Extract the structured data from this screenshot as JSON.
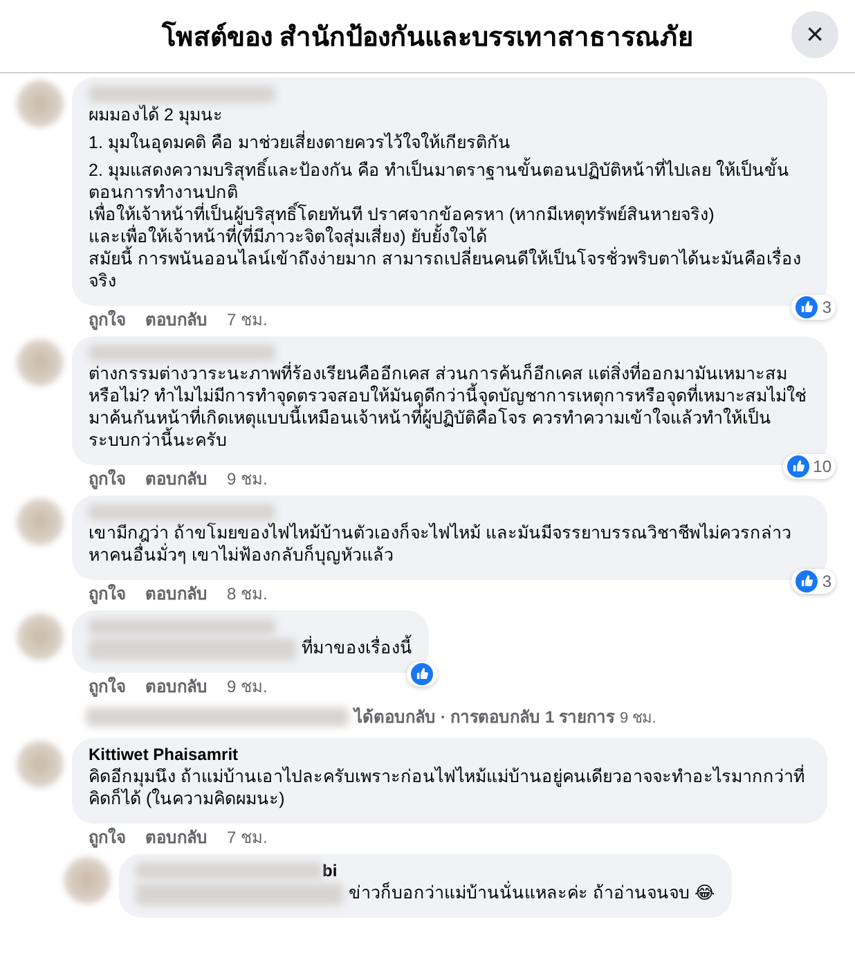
{
  "header": {
    "title": "โพสต์ของ สำนักป้องกันและบรรเทาสาธารณภัย",
    "close": "×"
  },
  "items": [
    {
      "kind": "comment",
      "name_blurred": true,
      "paragraphs": [
        "ผมมองได้ 2 มุมนะ",
        "1. มุมในอุดมคติ คือ มาช่วยเสี่ยงตายควรไว้ใจให้เกียรติกัน",
        "2. มุมแสดงความบริสุทธิ์และป้องกัน คือ ทำเป็นมาตราฐานขั้นตอนปฏิบัติหน้าที่ไปเลย ให้เป็นขั้นตอนการทำงานปกติ\nเพื่อให้เจ้าหน้าที่เป็นผู้บริสุทธิ์โดยทันที ปราศจากข้อครหา (หากมีเหตุทรัพย์สินหายจริง)\nและเพื่อให้เจ้าหน้าที่(ที่มีภาวะจิตใจสุ่มเสี่ยง) ยับยั้งใจได้\nสมัยนี้ การพนันออนไลน์เข้าถึงง่ายมาก สามารถเปลี่ยนคนดีให้เป็นโจรชั่วพริบตาได้นะมันคือเรื่องจริง"
      ],
      "reaction": true,
      "likes": "3",
      "like_label": "ถูกใจ",
      "reply_label": "ตอบกลับ",
      "time": "7 ชม."
    },
    {
      "kind": "comment",
      "name_blurred": true,
      "paragraphs": [
        "ต่างกรรมต่างวาระนะภาพที่ร้องเรียนคืออีกเคส ส่วนการค้นก็อีกเคส แต่สิ่งที่ออกมามันเหมาะสมหรือไม่? ทำไมไม่มีการทำจุดตรวจสอบให้มันดูดีกว่านี้จุดบัญชาการเหตุการหรือจุดที่เหมาะสมไม่ใช่มาค้นกันหน้าที่เกิดเหตุแบบนี้เหมือนเจ้าหน้าที่ผู้ปฏิบัติคือโจร ควรทำความเข้าใจแล้วทำให้เป็นระบบกว่านี้นะครับ"
      ],
      "reaction": true,
      "likes": "10",
      "like_label": "ถูกใจ",
      "reply_label": "ตอบกลับ",
      "time": "9 ชม."
    },
    {
      "kind": "comment",
      "name_blurred": true,
      "paragraphs": [
        "เขามีกฎว่า ถ้าขโมยของไฟไหม้บ้านตัวเองก็จะไฟไหม้ และมันมีจรรยาบรรณวิชาชีพไม่ควรกล่าวหาคนอื่นมั่วๆ เขาไม่ฟ้องกลับก็บุญหัวแล้ว"
      ],
      "reaction": true,
      "likes": "3",
      "like_label": "ถูกใจ",
      "reply_label": "ตอบกลับ",
      "time": "8 ชม."
    },
    {
      "kind": "comment",
      "name_blurred": true,
      "text_blurred_prefix": true,
      "paragraphs": [
        "ที่มาของเรื่องนี้"
      ],
      "reaction": true,
      "like_label": "ถูกใจ",
      "reply_label": "ตอบกลับ",
      "time": "9 ชม."
    },
    {
      "kind": "summary",
      "text": "ได้ตอบกลับ · การตอบกลับ 1 รายการ",
      "time": "9 ชม."
    },
    {
      "kind": "comment",
      "name": "Kittiwet Phaisamrit",
      "paragraphs": [
        "คิดอีกมุมนึง ถ้าแม่บ้านเอาไปละครับเพราะก่อนไฟไหม้แม่บ้านอยู่คนเดียวอาจจะทำอะไรมากกว่าที่คิดก็ได้ (ในความคิดผมนะ)"
      ],
      "like_label": "ถูกใจ",
      "reply_label": "ตอบกลับ",
      "time": "7 ชม."
    },
    {
      "kind": "reply",
      "name_blurred": true,
      "name": "bi",
      "text_blurred_prefix": true,
      "paragraphs": [
        "ข่าวก็บอกว่าแม่บ้านนั่นแหละค่ะ ถ้าอ่านจนจบ 😂"
      ]
    }
  ]
}
